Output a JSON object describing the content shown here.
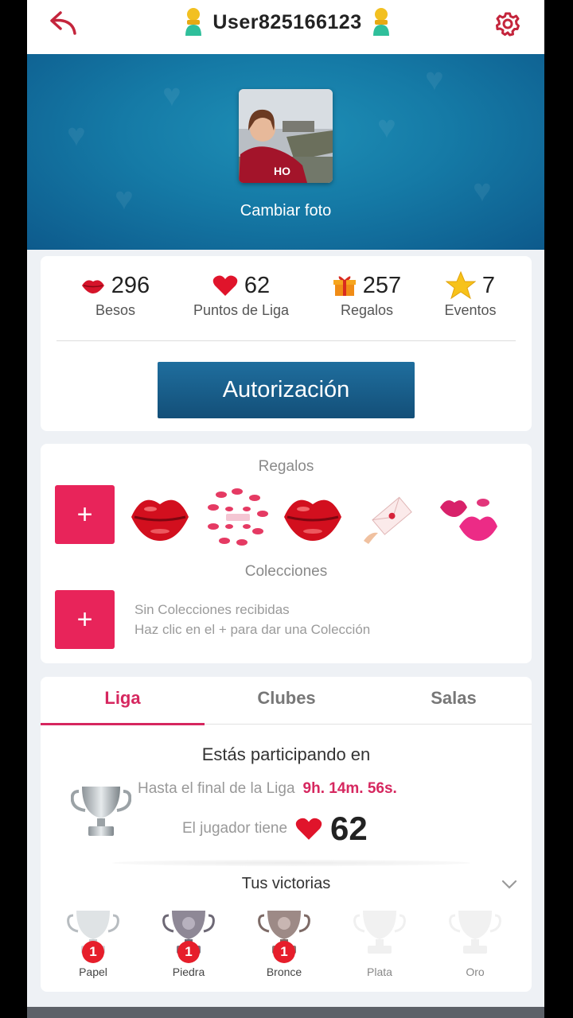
{
  "header": {
    "username": "User825166123"
  },
  "hero": {
    "change_photo": "Cambiar foto"
  },
  "stats": [
    {
      "icon": "lips-icon",
      "value": "296",
      "label": "Besos"
    },
    {
      "icon": "heart-icon",
      "value": "62",
      "label": "Puntos de Liga"
    },
    {
      "icon": "gift-icon",
      "value": "257",
      "label": "Regalos"
    },
    {
      "icon": "star-icon",
      "value": "7",
      "label": "Eventos"
    }
  ],
  "auth_button": "Autorización",
  "gifts": {
    "title": "Regalos",
    "plus": "+",
    "items": [
      "lips-kiss-icon",
      "kisses-wreath-icon",
      "lips-kiss-icon",
      "love-letter-icon",
      "pink-kisses-icon"
    ]
  },
  "collections": {
    "title": "Colecciones",
    "plus": "+",
    "empty_line1": "Sin Colecciones recibidas",
    "empty_line2": "Haz clic en el + para dar una Colección"
  },
  "league": {
    "tabs": [
      "Liga",
      "Clubes",
      "Salas"
    ],
    "active_tab": "Liga",
    "participating": "Estás participando en",
    "until_end_label": "Hasta el final de la Liga",
    "timer": "9h. 14m. 56s.",
    "player_has_label": "El jugador tiene",
    "points": "62",
    "victories_title": "Tus victorias",
    "victories": [
      {
        "label": "Papel",
        "count": "1"
      },
      {
        "label": "Piedra",
        "count": "1"
      },
      {
        "label": "Bronce",
        "count": "1"
      },
      {
        "label": "Plata",
        "count": ""
      },
      {
        "label": "Oro",
        "count": ""
      }
    ]
  },
  "colors": {
    "accent": "#d6275f",
    "button_blue": "#1a6190",
    "plus_pink": "#e8245a"
  }
}
